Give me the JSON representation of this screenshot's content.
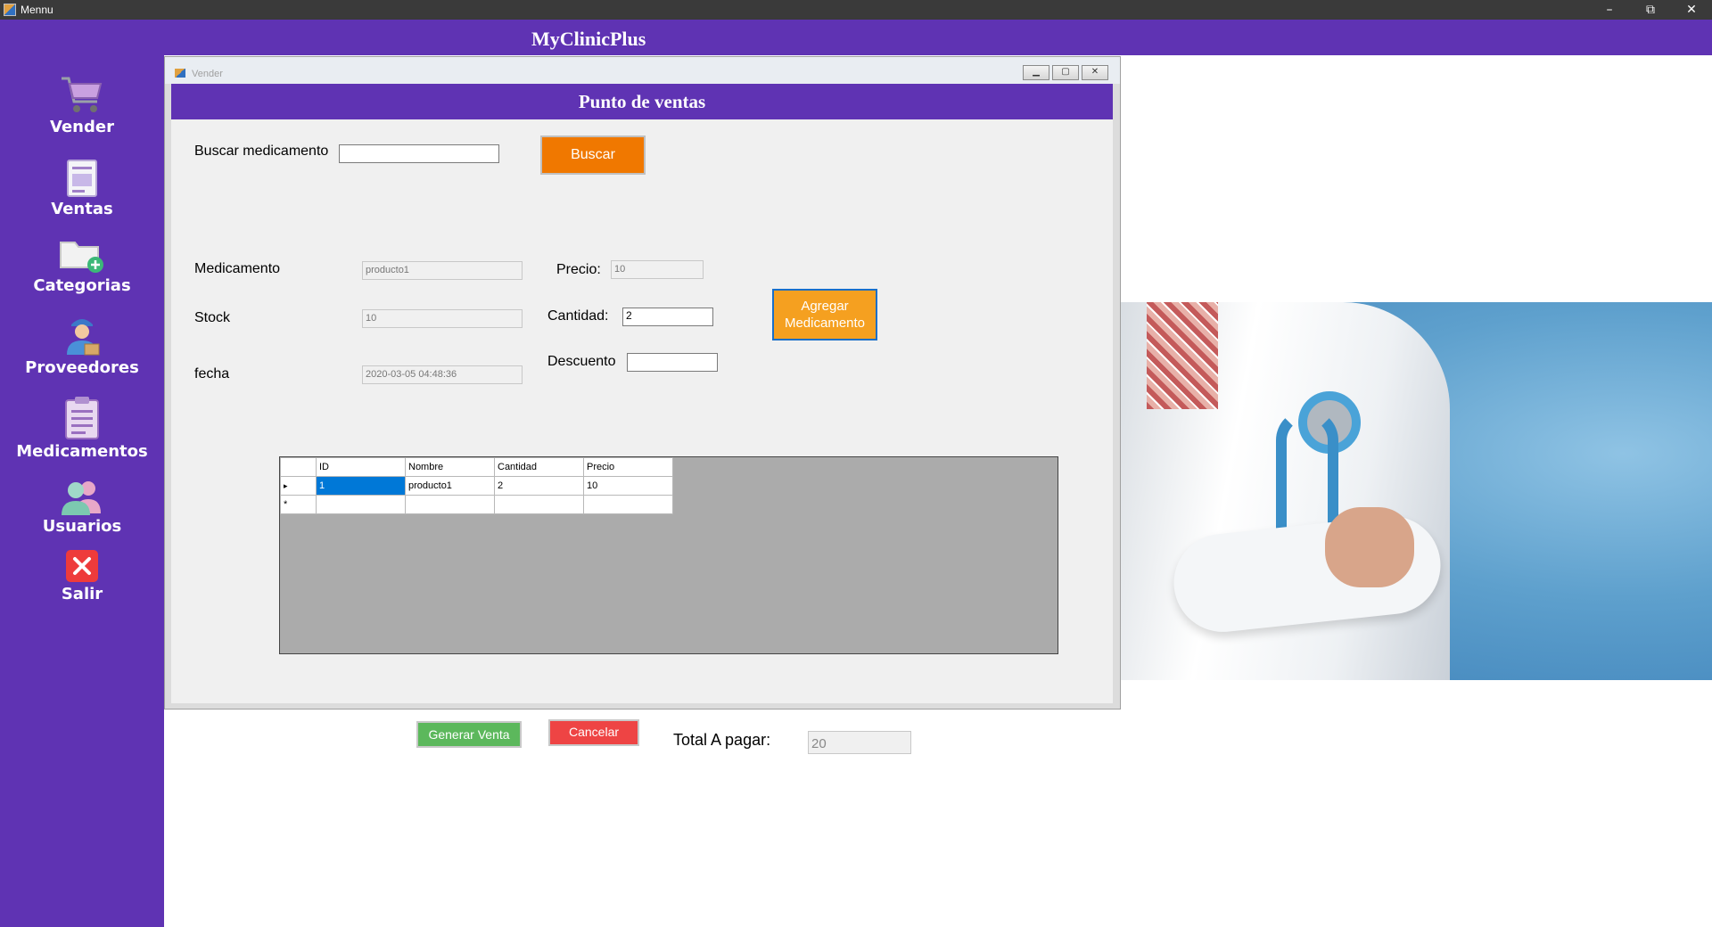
{
  "window": {
    "title": "Mennu",
    "minimize": "–",
    "restore": "⧉",
    "close": "✕"
  },
  "app": {
    "brand": "MyClinicPlus"
  },
  "sidebar": {
    "items": [
      {
        "label": "Vender",
        "icon": "cart-icon"
      },
      {
        "label": "Ventas",
        "icon": "document-icon"
      },
      {
        "label": "Categorias",
        "icon": "folder-add-icon"
      },
      {
        "label": "Proveedores",
        "icon": "delivery-man-icon"
      },
      {
        "label": "Medicamentos",
        "icon": "clipboard-icon"
      },
      {
        "label": "Usuarios",
        "icon": "users-icon"
      },
      {
        "label": "Salir",
        "icon": "exit-icon"
      }
    ]
  },
  "child": {
    "title": "Vender",
    "min": "▁",
    "max": "▢",
    "close": "✕"
  },
  "form": {
    "header": "Punto de ventas",
    "search_label": "Buscar medicamento",
    "search_value": "",
    "search_button": "Buscar",
    "medicamento_label": "Medicamento",
    "medicamento_value": "producto1",
    "precio_label": "Precio:",
    "precio_value": "10",
    "stock_label": "Stock",
    "stock_value": "10",
    "cantidad_label": "Cantidad:",
    "cantidad_value": "2",
    "agregar_button_line1": "Agregar",
    "agregar_button_line2": "Medicamento",
    "descuento_label": "Descuento",
    "descuento_value": "",
    "fecha_label": "fecha",
    "fecha_value": "2020-03-05 04:48:36",
    "generar_button": "Generar Venta",
    "cancelar_button": "Cancelar",
    "total_label": "Total A pagar:",
    "total_value": "20"
  },
  "grid": {
    "columns": [
      "ID",
      "Nombre",
      "Cantidad",
      "Precio"
    ],
    "rows": [
      {
        "marker": "▸",
        "cells": [
          "1",
          "producto1",
          "2",
          "10"
        ]
      }
    ],
    "new_row_marker": "*"
  },
  "colors": {
    "purple": "#5f33b3",
    "buscar": "#f07800",
    "agregar": "#f5a020",
    "generar": "#5cb85c",
    "cancelar": "#ee4444"
  }
}
